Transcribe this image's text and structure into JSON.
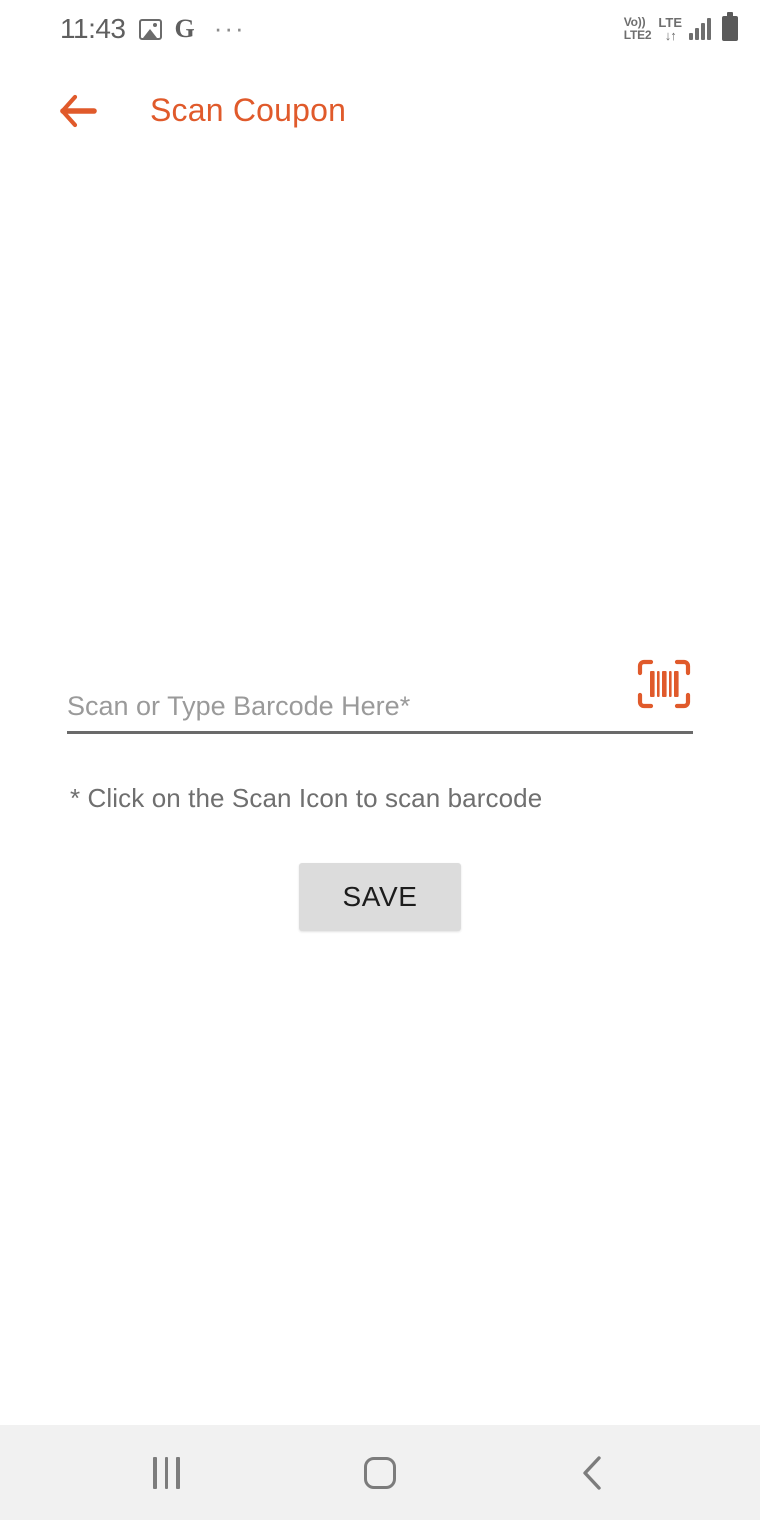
{
  "status_bar": {
    "clock": "11:43",
    "left_icons": [
      {
        "name": "photos-icon",
        "glyph": "image"
      },
      {
        "name": "google-icon",
        "glyph": "G"
      },
      {
        "name": "more-notifications-icon",
        "glyph": "···"
      }
    ],
    "volte_line1": "Vo))",
    "volte_line2": "LTE2",
    "network_label": "LTE",
    "data_arrows": "↓↑",
    "signal_bars": 4,
    "battery_icon": "battery-full-icon"
  },
  "app_bar": {
    "back_icon": "back-arrow-icon",
    "title": "Scan Coupon"
  },
  "form": {
    "barcode_input": {
      "value": "",
      "placeholder": "Scan or Type Barcode Here*"
    },
    "scan_icon": "barcode-scan-icon",
    "hint": "* Click on the Scan Icon to scan barcode",
    "save_label": "SAVE"
  },
  "nav_bar": {
    "recents_label": "recents-icon",
    "home_label": "home-icon",
    "back_label": "back-icon"
  },
  "colors": {
    "accent": "#E05A2B",
    "text_muted": "#6f6f6f",
    "placeholder": "#9a9a9a",
    "underline": "#6a6a6a",
    "button_bg": "#dcdcdc",
    "navbar_bg": "#f1f1f1"
  }
}
